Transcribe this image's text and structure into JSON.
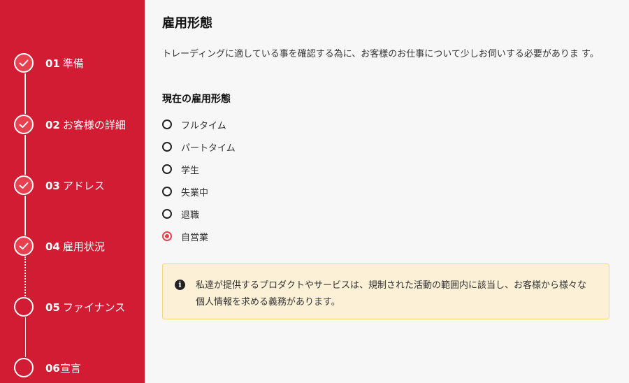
{
  "sidebar": {
    "steps": [
      {
        "num": "01",
        "label": "準備",
        "status": "done"
      },
      {
        "num": "02",
        "label": "お客様の詳細",
        "status": "done"
      },
      {
        "num": "03",
        "label": "アドレス",
        "status": "done"
      },
      {
        "num": "04",
        "label": "雇用状況",
        "status": "done"
      },
      {
        "num": "05",
        "label": "ファイナンス",
        "status": "pending"
      },
      {
        "num": "06",
        "label": "宣言",
        "status": "pending"
      }
    ]
  },
  "main": {
    "title": "雇用形態",
    "intro": "トレーディングに適している事を確認する為に、お客様のお仕事について少しお伺いする必要がありま す。",
    "question": "現在の雇用形態",
    "options": [
      {
        "label": "フルタイム",
        "checked": false
      },
      {
        "label": "パートタイム",
        "checked": false
      },
      {
        "label": "学生",
        "checked": false
      },
      {
        "label": "失業中",
        "checked": false
      },
      {
        "label": "退職",
        "checked": false
      },
      {
        "label": "自営業",
        "checked": true
      }
    ],
    "notice": {
      "icon": "info-icon",
      "text": "私達が提供するプロダクトやサービスは、規制された活動の範囲内に該当し、お客様から様々な個人情報を求める義務があります。"
    }
  },
  "colors": {
    "sidebar_bg": "#d21c33",
    "accent": "#e8404f",
    "notice_bg": "#fcf1d6",
    "notice_border": "#f2d77b"
  }
}
